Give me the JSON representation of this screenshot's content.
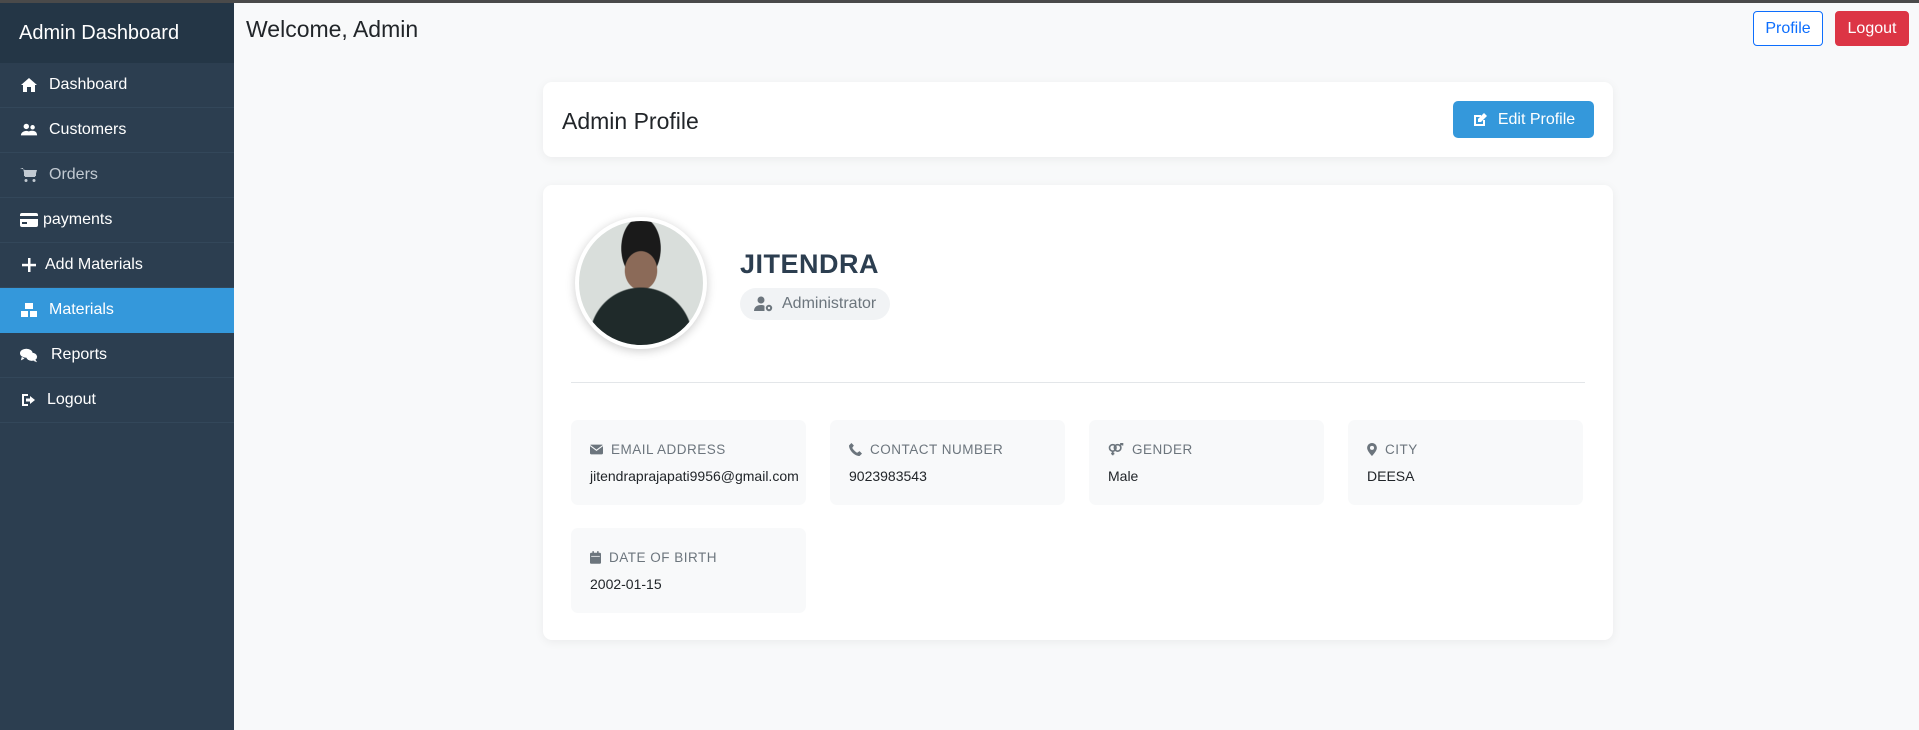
{
  "sidebar": {
    "brand": "Admin Dashboard",
    "items": [
      {
        "label": "Dashboard",
        "icon": "home-icon"
      },
      {
        "label": "Customers",
        "icon": "users-icon"
      },
      {
        "label": "Orders",
        "icon": "cart-icon"
      },
      {
        "label": "payments",
        "icon": "credit-card-icon"
      },
      {
        "label": "Add Materials",
        "icon": "plus-icon"
      },
      {
        "label": "Materials",
        "icon": "boxes-icon"
      },
      {
        "label": "Reports",
        "icon": "comments-icon"
      },
      {
        "label": "Logout",
        "icon": "sign-out-icon"
      }
    ]
  },
  "header": {
    "welcome": "Welcome, Admin",
    "profile_label": "Profile",
    "logout_label": "Logout"
  },
  "profile_header": {
    "title": "Admin Profile",
    "edit_label": "Edit Profile"
  },
  "profile": {
    "name": "JITENDRA",
    "role": "Administrator",
    "fields": [
      {
        "label": "EMAIL ADDRESS",
        "value": "jitendraprajapati9956@gmail.com",
        "icon": "envelope-icon"
      },
      {
        "label": "CONTACT NUMBER",
        "value": "9023983543",
        "icon": "phone-icon"
      },
      {
        "label": "GENDER",
        "value": "Male",
        "icon": "venus-mars-icon"
      },
      {
        "label": "CITY",
        "value": "DEESA",
        "icon": "map-marker-icon"
      },
      {
        "label": "DATE OF BIRTH",
        "value": "2002-01-15",
        "icon": "calendar-icon"
      }
    ]
  },
  "colors": {
    "sidebar_bg": "#2c3e50",
    "active": "#3498db",
    "logout": "#dc3545",
    "profile_outline": "#0d6efd"
  }
}
